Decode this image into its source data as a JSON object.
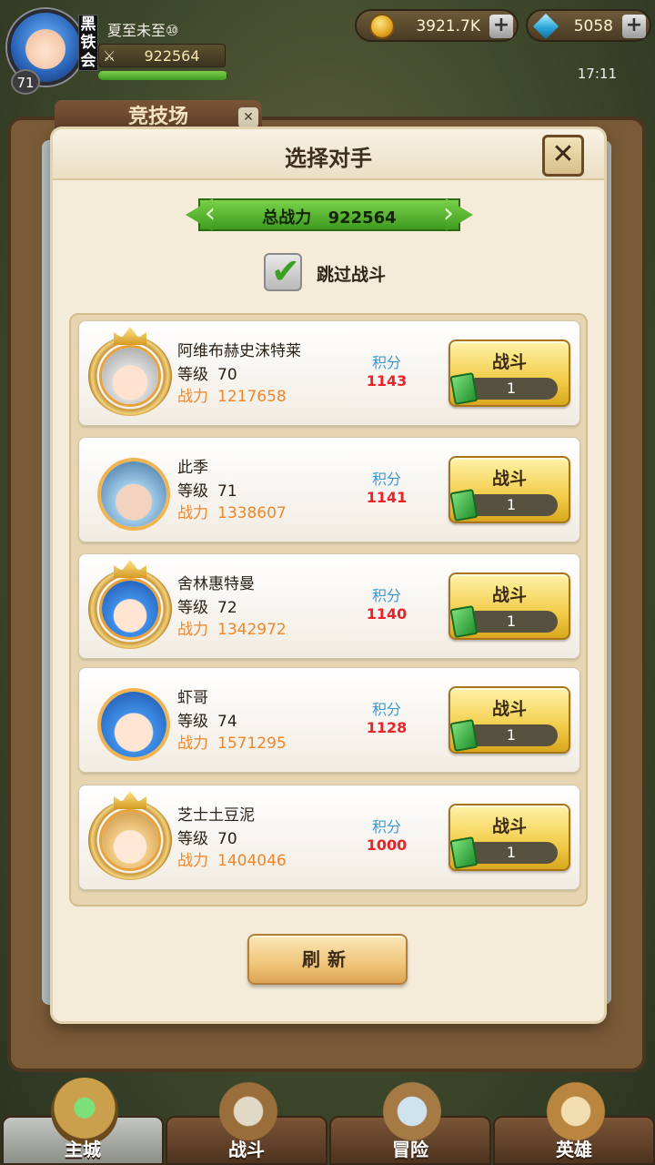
{
  "player": {
    "name": "夏至未至⑩",
    "level": "71",
    "vip_badge": "黑铁会",
    "power": "922564",
    "xp_fraction": 0.99
  },
  "resources": {
    "gold": "3921.7K",
    "gems": "5058",
    "plus": "+"
  },
  "clock": "17:11",
  "background": {
    "tab_title": "竞技场"
  },
  "modal": {
    "title": "选择对手",
    "close": "✕",
    "power_label": "总战力",
    "power_value": "922564",
    "skip_label": "跳过战斗",
    "skip_checked": true,
    "refresh_label": "刷新"
  },
  "labels": {
    "level": "等级",
    "power": "战力",
    "score": "积分",
    "fight": "战斗"
  },
  "opponents": [
    {
      "name": "阿维布赫史沫特莱",
      "level": "70",
      "power": "1217658",
      "score": "1143",
      "cost": "1",
      "portrait": "silver-hair-icon",
      "frame": "laurel"
    },
    {
      "name": "此季",
      "level": "71",
      "power": "1338607",
      "score": "1141",
      "cost": "1",
      "portrait": "masked-hero-icon",
      "frame": "plain"
    },
    {
      "name": "舍林惠特曼",
      "level": "72",
      "power": "1342972",
      "score": "1140",
      "cost": "1",
      "portrait": "blue-hair-icon",
      "frame": "laurel"
    },
    {
      "name": "虾哥",
      "level": "74",
      "power": "1571295",
      "score": "1128",
      "cost": "1",
      "portrait": "blue-hair-icon",
      "frame": "plain"
    },
    {
      "name": "芝士土豆泥",
      "level": "70",
      "power": "1404046",
      "score": "1000",
      "cost": "1",
      "portrait": "blonde-hair-icon",
      "frame": "laurel"
    }
  ],
  "nav": [
    {
      "label": "主城",
      "icon": "city-icon",
      "active": true
    },
    {
      "label": "战斗",
      "icon": "crossed-swords-icon",
      "active": false
    },
    {
      "label": "冒险",
      "icon": "adventure-map-icon",
      "active": false
    },
    {
      "label": "英雄",
      "icon": "hero-crest-icon",
      "active": false
    }
  ],
  "colors": {
    "score_label": "#3a9ad8",
    "score_value": "#e8232a",
    "power_text": "#f0862a",
    "banner_green": "#3f9a1f"
  }
}
